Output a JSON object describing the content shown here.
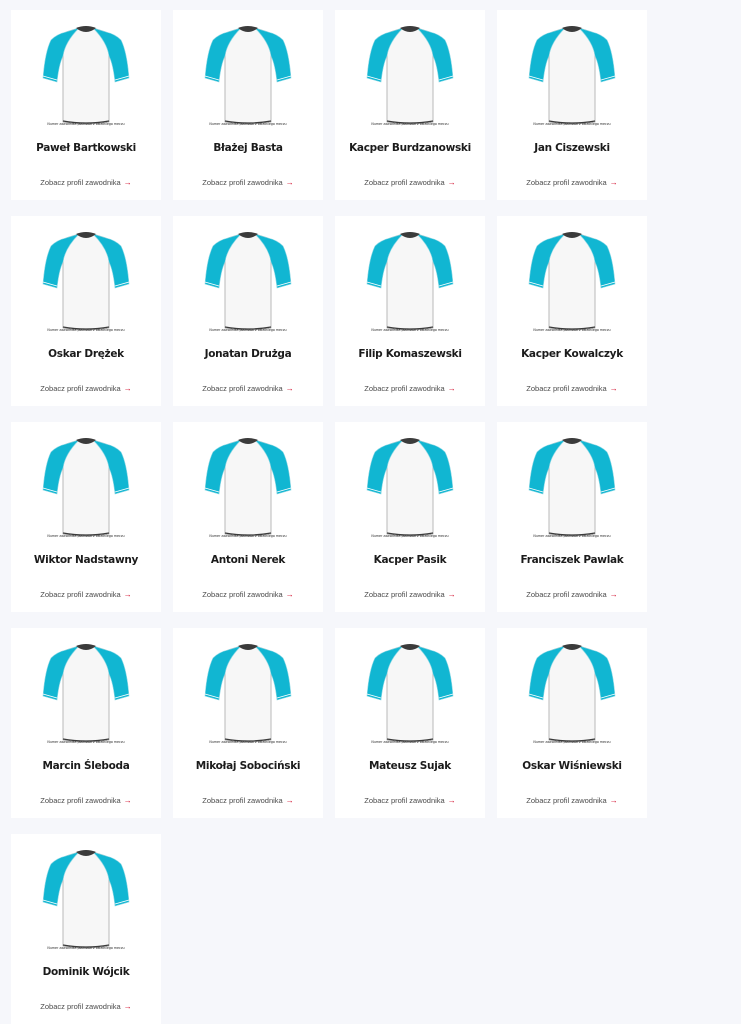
{
  "colors": {
    "page_bg": "#f6f7fb",
    "card_bg": "#ffffff",
    "sleeve": "#11b6d2",
    "collar": "#3b3b3b",
    "arrow": "#d10a2a"
  },
  "labels": {
    "shirt_caption": "Numer zawodnika pochodzi z ostatniego meczu",
    "profile_link": "Zobacz profil zawodnika",
    "arrow_icon": "→"
  },
  "players": [
    {
      "name": "Paweł Bartkowski"
    },
    {
      "name": "Błażej Basta"
    },
    {
      "name": "Kacper Burdzanowski"
    },
    {
      "name": "Jan Ciszewski"
    },
    {
      "name": "Oskar Drężek"
    },
    {
      "name": "Jonatan Drużga"
    },
    {
      "name": "Filip Komaszewski"
    },
    {
      "name": "Kacper Kowalczyk"
    },
    {
      "name": "Wiktor Nadstawny"
    },
    {
      "name": "Antoni Nerek"
    },
    {
      "name": "Kacper Pasik"
    },
    {
      "name": "Franciszek Pawlak"
    },
    {
      "name": "Marcin Śleboda"
    },
    {
      "name": "Mikołaj Sobociński"
    },
    {
      "name": "Mateusz Sujak"
    },
    {
      "name": "Oskar Wiśniewski"
    },
    {
      "name": "Dominik Wójcik"
    }
  ]
}
